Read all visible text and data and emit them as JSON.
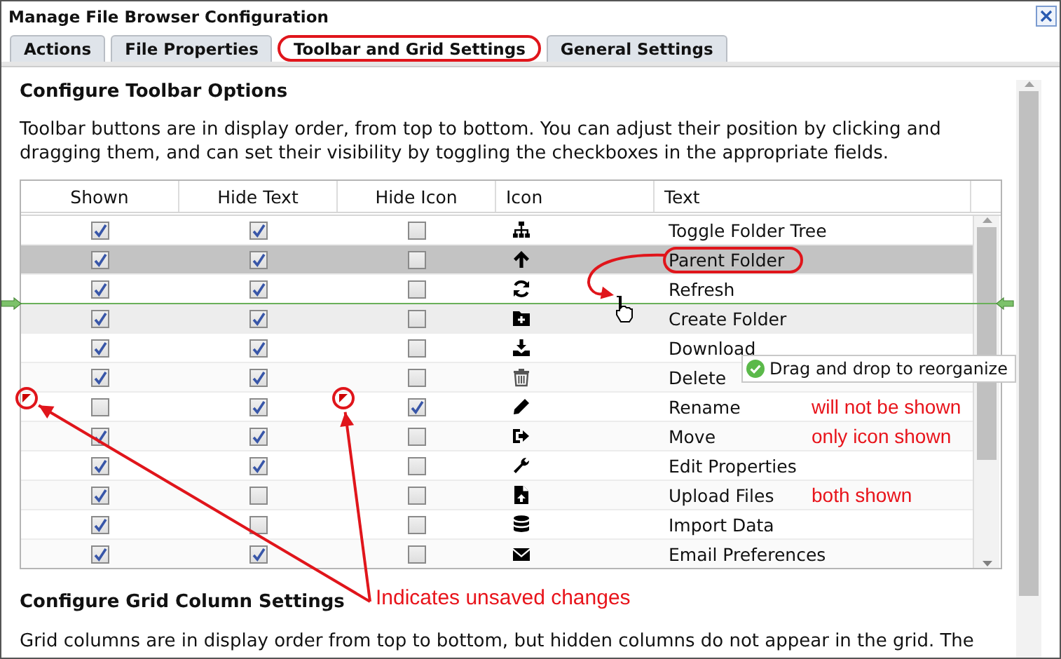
{
  "window": {
    "title": "Manage File Browser Configuration"
  },
  "tabs": [
    {
      "label": "Actions",
      "selected": false,
      "circled": false
    },
    {
      "label": "File Properties",
      "selected": false,
      "circled": false
    },
    {
      "label": "Toolbar and Grid Settings",
      "selected": true,
      "circled": true
    },
    {
      "label": "General Settings",
      "selected": false,
      "circled": false
    }
  ],
  "toolbar": {
    "heading": "Configure Toolbar Options",
    "description": "Toolbar buttons are in display order, from top to bottom. You can adjust their position by clicking and dragging them, and can set their visibility by toggling the checkboxes in the appropriate fields.",
    "columns": [
      "Shown",
      "Hide Text",
      "Hide Icon",
      "Icon",
      "Text"
    ],
    "rows": [
      {
        "text": "Toggle Folder Tree",
        "selected": false,
        "hovered": false,
        "circled": false,
        "checks": [
          {
            "checked": true,
            "dirty": false
          },
          {
            "checked": true,
            "dirty": false
          },
          {
            "checked": false,
            "dirty": false
          }
        ]
      },
      {
        "text": "Parent Folder",
        "selected": true,
        "hovered": false,
        "circled": true,
        "checks": [
          {
            "checked": true,
            "dirty": false
          },
          {
            "checked": true,
            "dirty": false
          },
          {
            "checked": false,
            "dirty": false
          }
        ]
      },
      {
        "text": "Refresh",
        "selected": false,
        "hovered": false,
        "circled": false,
        "checks": [
          {
            "checked": true,
            "dirty": false
          },
          {
            "checked": true,
            "dirty": false
          },
          {
            "checked": false,
            "dirty": false
          }
        ]
      },
      {
        "text": "Create Folder",
        "selected": false,
        "hovered": true,
        "circled": false,
        "checks": [
          {
            "checked": true,
            "dirty": false
          },
          {
            "checked": true,
            "dirty": false
          },
          {
            "checked": false,
            "dirty": false
          }
        ]
      },
      {
        "text": "Download",
        "selected": false,
        "hovered": false,
        "circled": false,
        "checks": [
          {
            "checked": true,
            "dirty": false
          },
          {
            "checked": true,
            "dirty": false
          },
          {
            "checked": false,
            "dirty": false
          }
        ]
      },
      {
        "text": "Delete",
        "selected": false,
        "hovered": false,
        "circled": false,
        "checks": [
          {
            "checked": true,
            "dirty": false
          },
          {
            "checked": true,
            "dirty": false
          },
          {
            "checked": false,
            "dirty": false
          }
        ]
      },
      {
        "text": "Rename",
        "selected": false,
        "hovered": false,
        "circled": false,
        "checks": [
          {
            "checked": false,
            "dirty": true
          },
          {
            "checked": true,
            "dirty": false
          },
          {
            "checked": true,
            "dirty": true
          }
        ],
        "note": "will not be shown"
      },
      {
        "text": "Move",
        "selected": false,
        "hovered": false,
        "circled": false,
        "checks": [
          {
            "checked": true,
            "dirty": false
          },
          {
            "checked": true,
            "dirty": false
          },
          {
            "checked": false,
            "dirty": false
          }
        ],
        "note": "only icon shown"
      },
      {
        "text": "Edit Properties",
        "selected": false,
        "hovered": false,
        "circled": false,
        "checks": [
          {
            "checked": true,
            "dirty": false
          },
          {
            "checked": true,
            "dirty": false
          },
          {
            "checked": false,
            "dirty": false
          }
        ]
      },
      {
        "text": "Upload Files",
        "selected": false,
        "hovered": false,
        "circled": false,
        "checks": [
          {
            "checked": true,
            "dirty": false
          },
          {
            "checked": false,
            "dirty": false
          },
          {
            "checked": false,
            "dirty": false
          }
        ],
        "note": "both shown"
      },
      {
        "text": "Import Data",
        "selected": false,
        "hovered": false,
        "circled": false,
        "checks": [
          {
            "checked": true,
            "dirty": false
          },
          {
            "checked": false,
            "dirty": false
          },
          {
            "checked": false,
            "dirty": false
          }
        ]
      },
      {
        "text": "Email Preferences",
        "selected": false,
        "hovered": false,
        "circled": false,
        "checks": [
          {
            "checked": true,
            "dirty": false
          },
          {
            "checked": true,
            "dirty": false
          },
          {
            "checked": false,
            "dirty": false
          }
        ]
      }
    ]
  },
  "drag_tooltip": "Drag and drop to reorganize",
  "unsaved_note": "Indicates unsaved changes",
  "grid_section": {
    "heading": "Configure Grid Column Settings",
    "description": "Grid columns are in display order from top to bottom, but hidden columns do not appear in the grid. The"
  }
}
